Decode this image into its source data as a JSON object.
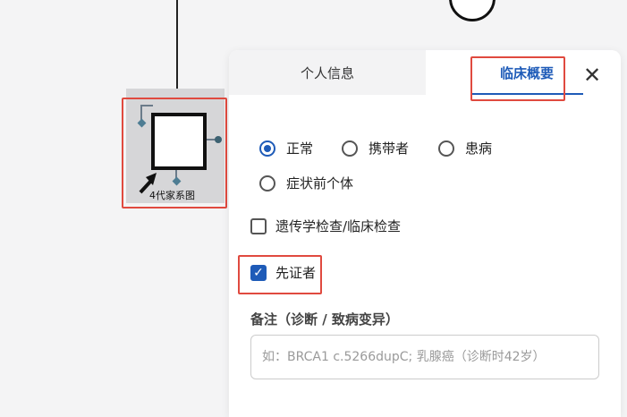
{
  "pedigree": {
    "node_label": "4代家系图"
  },
  "panel": {
    "tabs": [
      {
        "label": "个人信息",
        "active": false
      },
      {
        "label": "临床概要",
        "active": true
      }
    ],
    "close_icon": "close-icon",
    "status_options": [
      {
        "label": "正常",
        "selected": true
      },
      {
        "label": "携带者",
        "selected": false
      },
      {
        "label": "患病",
        "selected": false
      },
      {
        "label": "症状前个体",
        "selected": false
      }
    ],
    "genetic_test": {
      "label": "遗传学检查/临床检查",
      "checked": false
    },
    "proband": {
      "label": "先证者",
      "checked": true
    },
    "notes": {
      "label": "备注（诊断 / 致病变异）",
      "placeholder": "如：BRCA1 c.5266dupC; 乳腺癌（诊断时42岁）",
      "value": ""
    }
  },
  "colors": {
    "accent": "#1e5bb8",
    "highlight": "#e04a3f"
  }
}
